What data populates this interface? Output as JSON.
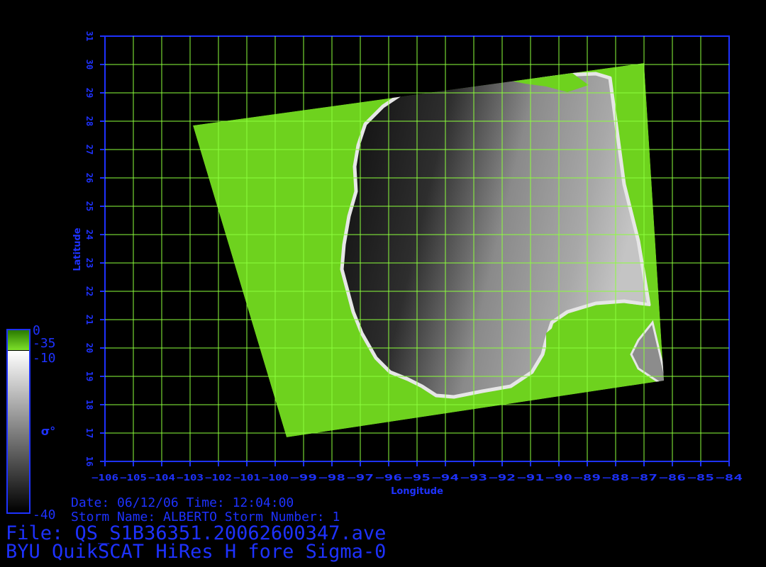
{
  "map": {
    "xlabel": "Longitude",
    "ylabel": "Latitude",
    "lon_range": [
      -106,
      -84
    ],
    "lat_range": [
      16,
      31
    ],
    "lon_ticks": [
      -106,
      -105,
      -104,
      -103,
      -102,
      -101,
      -100,
      -99,
      -98,
      -97,
      -96,
      -95,
      -94,
      -93,
      -92,
      -91,
      -90,
      -89,
      -88,
      -87,
      -86,
      -85,
      -84
    ],
    "lat_ticks": [
      16,
      17,
      18,
      19,
      20,
      21,
      22,
      23,
      24,
      25,
      26,
      27,
      28,
      29,
      30,
      31
    ],
    "grid": true,
    "colors": {
      "frame": "#1e32ff",
      "grid": "#8cff3c",
      "land": "#6ed21e",
      "background": "#000000"
    },
    "swath_corners_lonlat": [
      [
        -102.9,
        27.85
      ],
      [
        -87.0,
        30.05
      ],
      [
        -86.3,
        18.85
      ],
      [
        -99.6,
        16.85
      ]
    ]
  },
  "colorbar": {
    "land_top": "0",
    "land_bottom": "-35",
    "ocean_top": "-10",
    "ocean_bottom": "-40",
    "symbol": "σ°"
  },
  "info": {
    "date_line": "Date: 06/12/06   Time: 12:04:00",
    "storm_line": "Storm  Name: ALBERTO   Storm  Number: 1",
    "file_line": "File: QS_S1B36351.20062600347.ave",
    "product_line": "BYU QuikSCAT HiRes H fore Sigma-0"
  }
}
